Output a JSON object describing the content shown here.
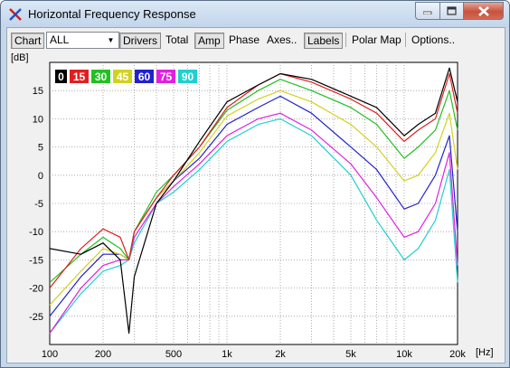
{
  "window": {
    "title": "Horizontal Frequency Response"
  },
  "toolbar": {
    "chart": "Chart",
    "all": "ALL",
    "drivers": "Drivers",
    "total": "Total",
    "amp": "Amp",
    "phase": "Phase",
    "axes": "Axes..",
    "labels": "Labels",
    "polar_map": "Polar Map",
    "options": "Options.."
  },
  "chart_data": {
    "type": "line",
    "ylabel": "[dB]",
    "xlabel": "[Hz]",
    "xscale": "log",
    "xlim": [
      100,
      20000
    ],
    "ylim": [
      -30,
      20
    ],
    "grid": true,
    "legend_placement": "top-left",
    "x_ticks": [
      "100",
      "200",
      "500",
      "1k",
      "2k",
      "5k",
      "10k",
      "20k"
    ],
    "y_ticks": [
      "15",
      "10",
      "5",
      "0",
      "-5",
      "-10",
      "-15",
      "-20",
      "-25"
    ],
    "x": [
      100,
      150,
      200,
      250,
      280,
      300,
      400,
      500,
      700,
      1000,
      1500,
      2000,
      3000,
      5000,
      7000,
      10000,
      12000,
      15000,
      18000,
      20000
    ],
    "series": [
      {
        "name": "0",
        "color": "#000000",
        "values": [
          -13,
          -14,
          -12,
          -15,
          -28,
          -18,
          -5,
          -1,
          6,
          13,
          16,
          18,
          17,
          14,
          12,
          7,
          9,
          11,
          19,
          13
        ]
      },
      {
        "name": "15",
        "color": "#e02020",
        "values": [
          -20,
          -13,
          -9.5,
          -11,
          -15,
          -10,
          -4,
          0,
          5,
          12,
          16,
          18,
          16.5,
          13.5,
          11,
          6,
          8,
          10,
          18,
          11
        ]
      },
      {
        "name": "30",
        "color": "#22c022",
        "values": [
          -19,
          -14,
          -11,
          -13,
          -15,
          -10,
          -3,
          0,
          5,
          11.5,
          15,
          17,
          15,
          12,
          9,
          3,
          5,
          8,
          15,
          8
        ]
      },
      {
        "name": "45",
        "color": "#d2d21e",
        "values": [
          -23,
          -17,
          -13,
          -14,
          -15,
          -10,
          -4,
          -1,
          4,
          10.5,
          13.5,
          15,
          13,
          9,
          5,
          -1,
          0,
          4,
          11,
          1
        ]
      },
      {
        "name": "60",
        "color": "#2222cc",
        "values": [
          -25,
          -18,
          -14,
          -14,
          -15,
          -10,
          -4,
          -1,
          3,
          9,
          12,
          14,
          11,
          5,
          1,
          -6,
          -5,
          0,
          7,
          -10
        ]
      },
      {
        "name": "75",
        "color": "#e020e0",
        "values": [
          -28,
          -20,
          -16,
          -15,
          -15,
          -11,
          -5,
          -2,
          2,
          7,
          10,
          11,
          8,
          2,
          -4,
          -11,
          -10,
          -5,
          4,
          -16
        ]
      },
      {
        "name": "90",
        "color": "#20d0d0",
        "values": [
          -28,
          -21,
          -17,
          -16,
          -15,
          -12,
          -5,
          -3,
          1,
          6,
          9,
          10,
          7,
          0,
          -8,
          -15,
          -13,
          -8,
          1,
          -19
        ]
      }
    ]
  }
}
